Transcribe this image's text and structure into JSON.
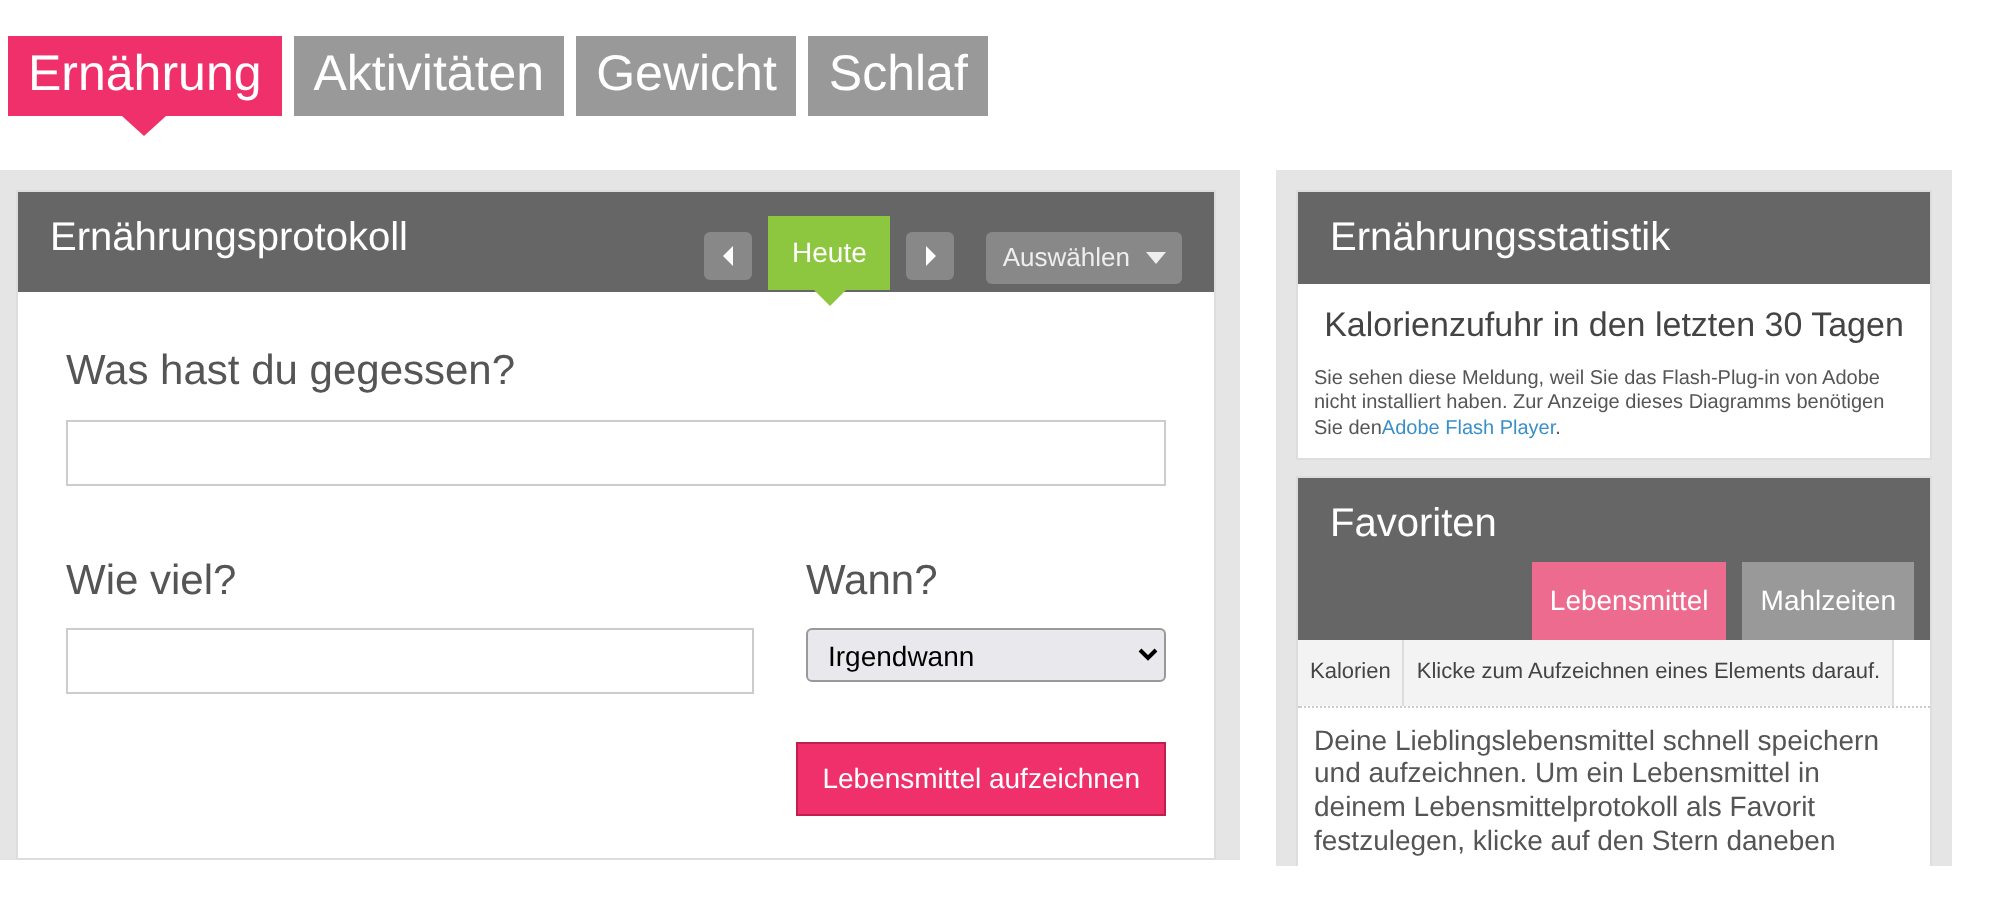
{
  "tabs": [
    {
      "label": "Ernährung",
      "selected": true
    },
    {
      "label": "Aktivitäten",
      "selected": false
    },
    {
      "label": "Gewicht",
      "selected": false
    },
    {
      "label": "Schlaf",
      "selected": false
    }
  ],
  "log": {
    "title": "Ernährungsprotokoll",
    "day": "Heute",
    "select_menu": "Auswählen",
    "question": "Was hast du gegessen?",
    "amount_label": "Wie viel?",
    "when_label": "Wann?",
    "when_value": "Irgendwann",
    "submit": "Lebensmittel aufzeichnen"
  },
  "stats": {
    "title": "Ernährungsstatistik",
    "chart_title": "Kalorienzufuhr in den letzten 30 Tagen",
    "notice": "Sie sehen diese Meldung, weil Sie das Flash-Plug-in von Adobe nicht installiert haben. Zur Anzeige dieses Diagramms benötigen Sie den",
    "notice_link": "Adobe Flash Player",
    "notice_end": "."
  },
  "favorites": {
    "title": "Favoriten",
    "tabs": [
      {
        "label": "Lebensmittel",
        "selected": true
      },
      {
        "label": "Mahlzeiten",
        "selected": false
      }
    ],
    "columns": [
      "Kalorien",
      "Klicke zum Aufzeichnen eines Elements darauf."
    ],
    "text": "Deine Lieblingslebensmittel schnell speichern und aufzeichnen. Um ein Lebensmittel in deinem Lebensmittelprotokoll als Favorit festzulegen, klicke auf den Stern daneben"
  }
}
